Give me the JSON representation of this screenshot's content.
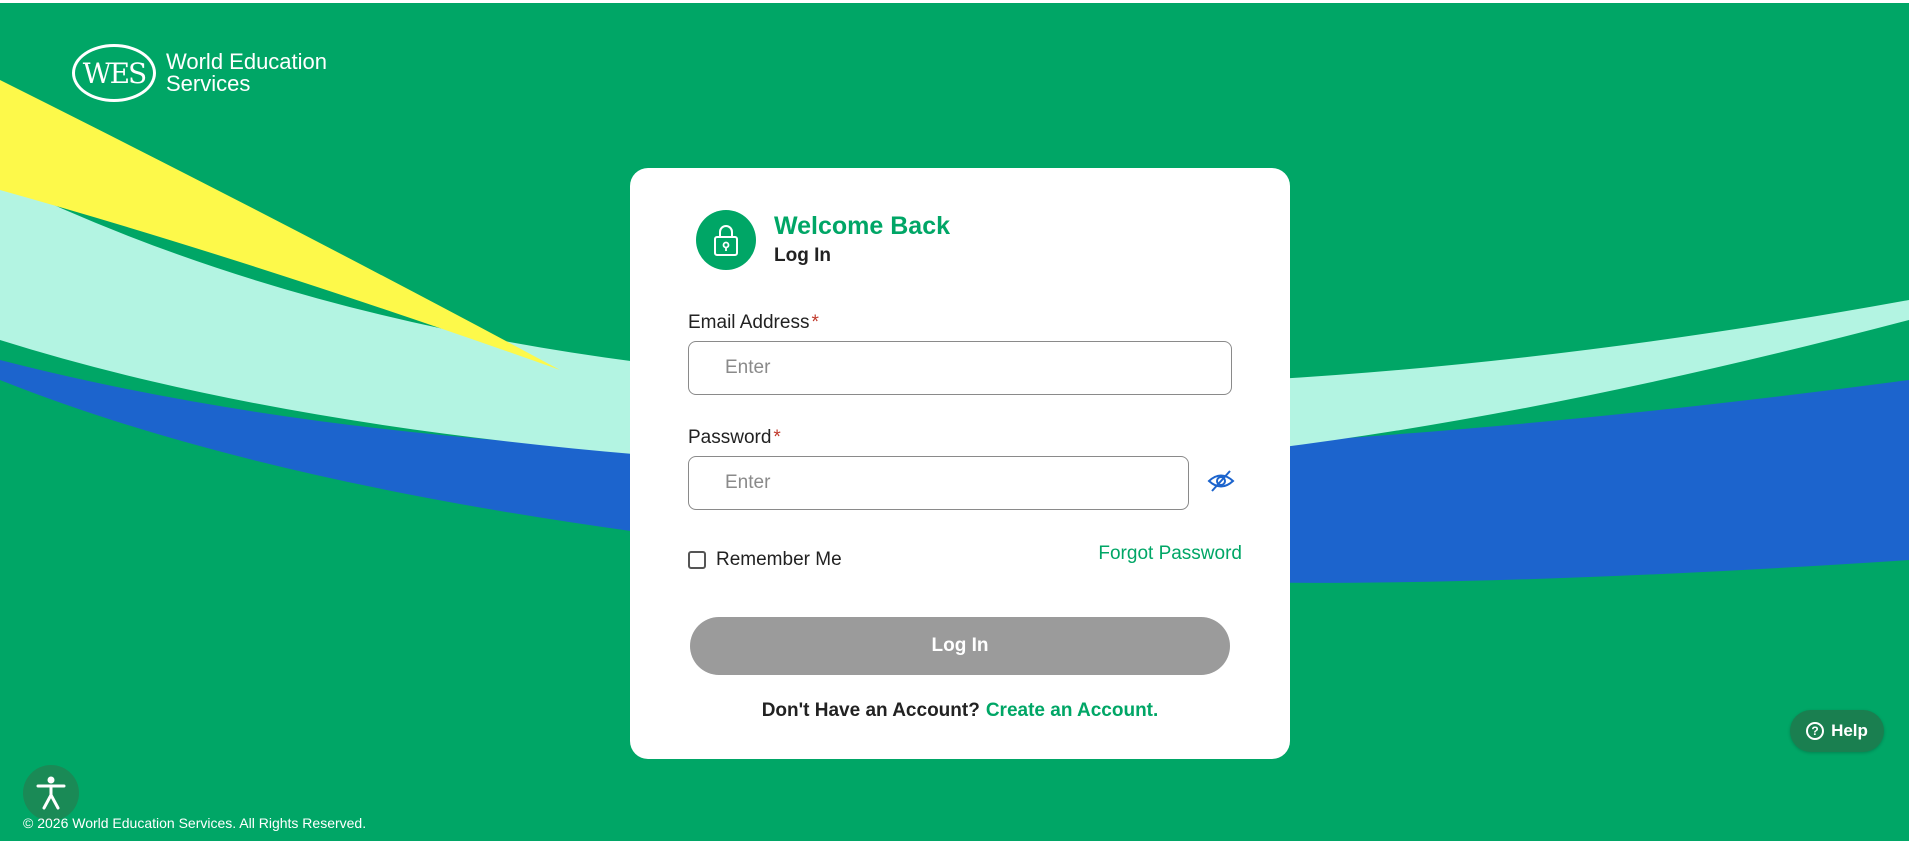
{
  "brand": {
    "logo_text": "WES",
    "name_line1": "World Education",
    "name_line2": "Services"
  },
  "card": {
    "title": "Welcome Back",
    "subtitle": "Log In",
    "email": {
      "label": "Email Address",
      "required_mark": "*",
      "placeholder": "Enter",
      "value": ""
    },
    "password": {
      "label": "Password",
      "required_mark": "*",
      "placeholder": "Enter",
      "value": ""
    },
    "remember_label": "Remember Me",
    "remember_checked": false,
    "forgot_label": "Forgot Password",
    "login_label": "Log In",
    "signup_question": "Don't Have an Account?",
    "signup_link": "Create an Account."
  },
  "help": {
    "label": "Help",
    "icon_glyph": "?"
  },
  "footer": {
    "copyright": "© 2026 World Education Services. All Rights Reserved."
  },
  "icons": {
    "lock": "lock-icon",
    "eye": "eye-slash-icon",
    "help": "question-icon",
    "accessibility": "accessibility-icon"
  },
  "colors": {
    "brand_green": "#00a666",
    "wave_yellow": "#fdf94a",
    "wave_mint": "#b3f4e2",
    "wave_blue": "#1c64cd",
    "button_disabled": "#9b9b9b"
  }
}
